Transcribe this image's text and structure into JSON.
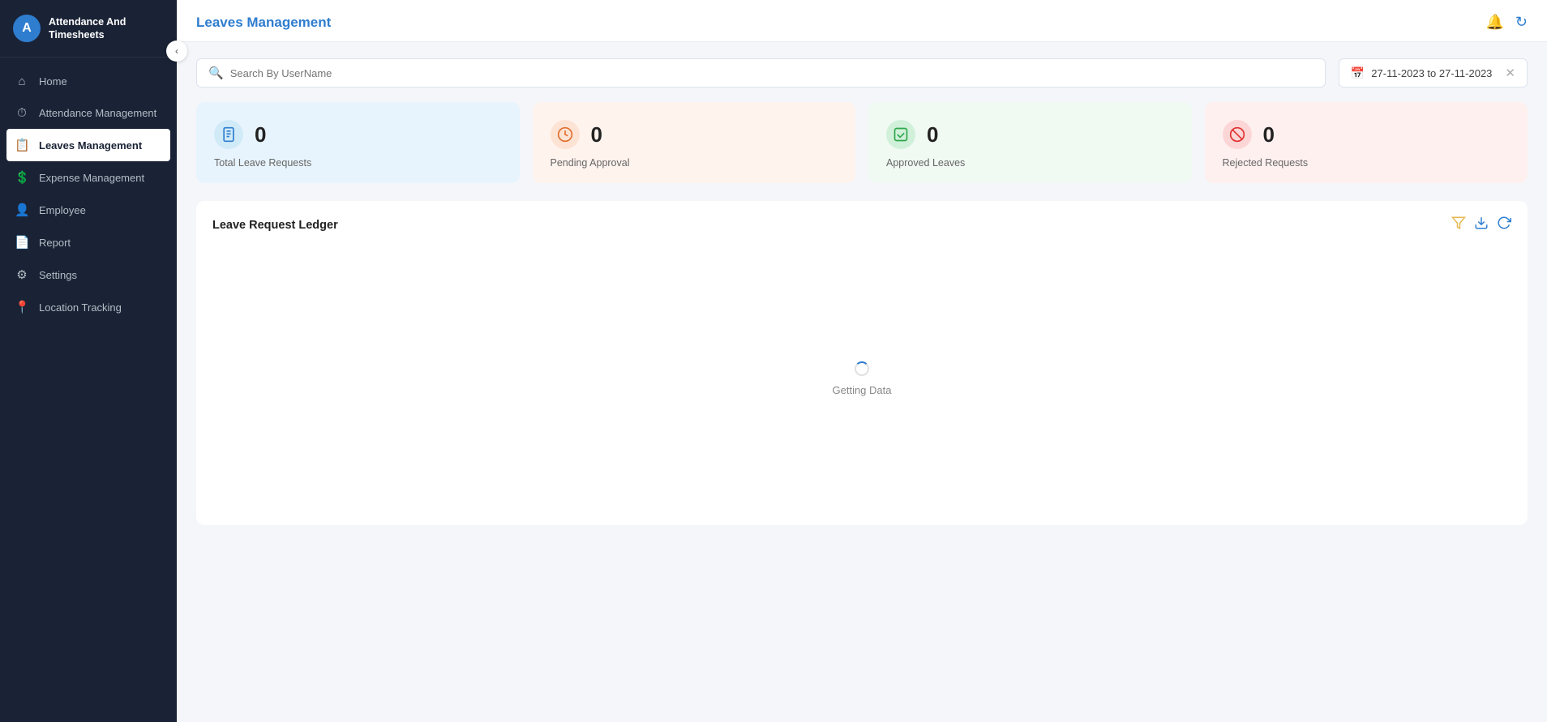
{
  "app": {
    "name": "Attendance And",
    "name2": "Timesheets",
    "logo_char": "A"
  },
  "sidebar": {
    "items": [
      {
        "id": "home",
        "label": "Home",
        "icon": "⌂"
      },
      {
        "id": "attendance",
        "label": "Attendance Management",
        "icon": "⏱"
      },
      {
        "id": "leaves",
        "label": "Leaves Management",
        "icon": "📋",
        "active": true
      },
      {
        "id": "expense",
        "label": "Expense Management",
        "icon": "$"
      },
      {
        "id": "employee",
        "label": "Employee",
        "icon": "👤"
      },
      {
        "id": "report",
        "label": "Report",
        "icon": "📄"
      },
      {
        "id": "settings",
        "label": "Settings",
        "icon": "⚙"
      },
      {
        "id": "location",
        "label": "Location Tracking",
        "icon": "📍"
      }
    ],
    "collapse_icon": "‹"
  },
  "topbar": {
    "title": "Leaves Management",
    "bell_icon": "🔔",
    "refresh_icon": "↻"
  },
  "search": {
    "placeholder": "Search By UserName"
  },
  "date_range": {
    "value": "27-11-2023 to 27-11-2023",
    "icon": "📅"
  },
  "stat_cards": [
    {
      "id": "total",
      "label": "Total Leave Requests",
      "value": "0",
      "color": "blue",
      "icon": "📋"
    },
    {
      "id": "pending",
      "label": "Pending Approval",
      "value": "0",
      "color": "orange",
      "icon": "⏱"
    },
    {
      "id": "approved",
      "label": "Approved Leaves",
      "value": "0",
      "color": "green",
      "icon": "✓"
    },
    {
      "id": "rejected",
      "label": "Rejected Requests",
      "value": "0",
      "color": "red",
      "icon": "⊘"
    }
  ],
  "ledger": {
    "title": "Leave Request Ledger",
    "filter_icon": "▽",
    "download_icon": "⬇",
    "refresh_icon": "↻",
    "loading_text": "Getting Data"
  }
}
